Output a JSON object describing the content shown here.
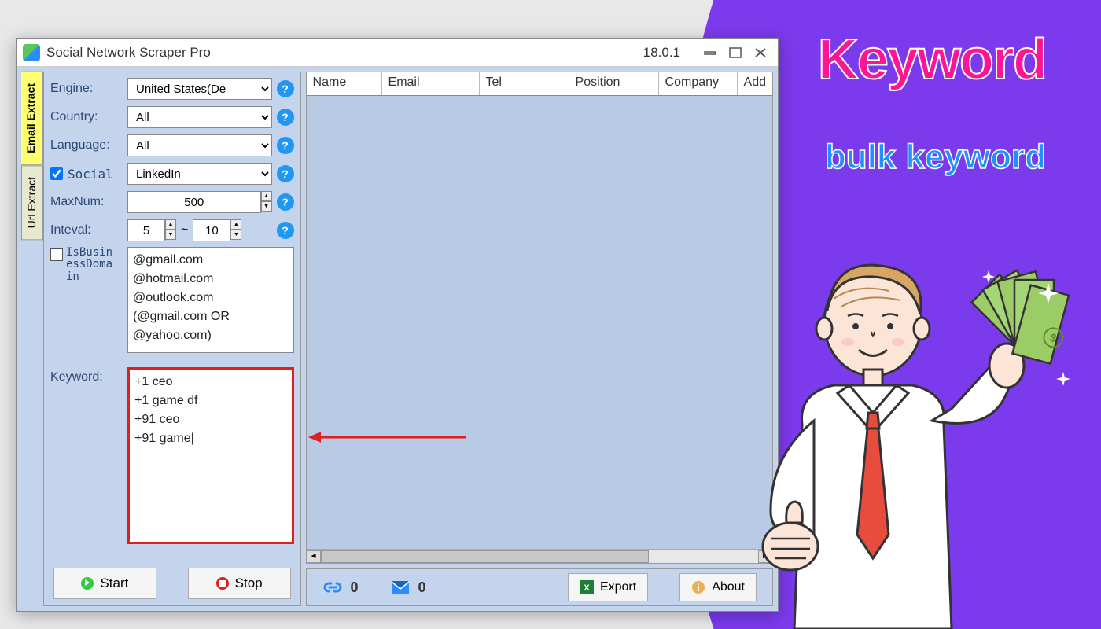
{
  "promo": {
    "keyword": "Keyword",
    "bulk": "bulk keyword"
  },
  "window": {
    "title": "Social Network Scraper Pro",
    "version": "18.0.1"
  },
  "sideTabs": {
    "emailExtract": "Email Extract",
    "urlExtract": "Url Extract"
  },
  "form": {
    "engineLabel": "Engine:",
    "engineValue": "United States(De",
    "countryLabel": "Country:",
    "countryValue": "All",
    "languageLabel": "Language:",
    "languageValue": "All",
    "socialLabel": "Social",
    "socialValue": "LinkedIn",
    "maxNumLabel": "MaxNum:",
    "maxNumValue": "500",
    "intervalLabel": "Inteval:",
    "intervalFrom": "5",
    "intervalSep": "~",
    "intervalTo": "10",
    "isBusinessLabel": "IsBusinessDomain",
    "domainsText": "@gmail.com\n@hotmail.com\n@outlook.com\n(@gmail.com OR\n@yahoo.com)",
    "keywordLabel": "Keyword:",
    "keywordText": "+1 ceo\n+1 game df\n+91 ceo\n+91 game|"
  },
  "buttons": {
    "start": "Start",
    "stop": "Stop",
    "export": "Export",
    "about": "About"
  },
  "table": {
    "columns": [
      "Name",
      "Email",
      "Tel",
      "Position",
      "Company",
      "Add"
    ]
  },
  "stats": {
    "links": "0",
    "emails": "0"
  }
}
